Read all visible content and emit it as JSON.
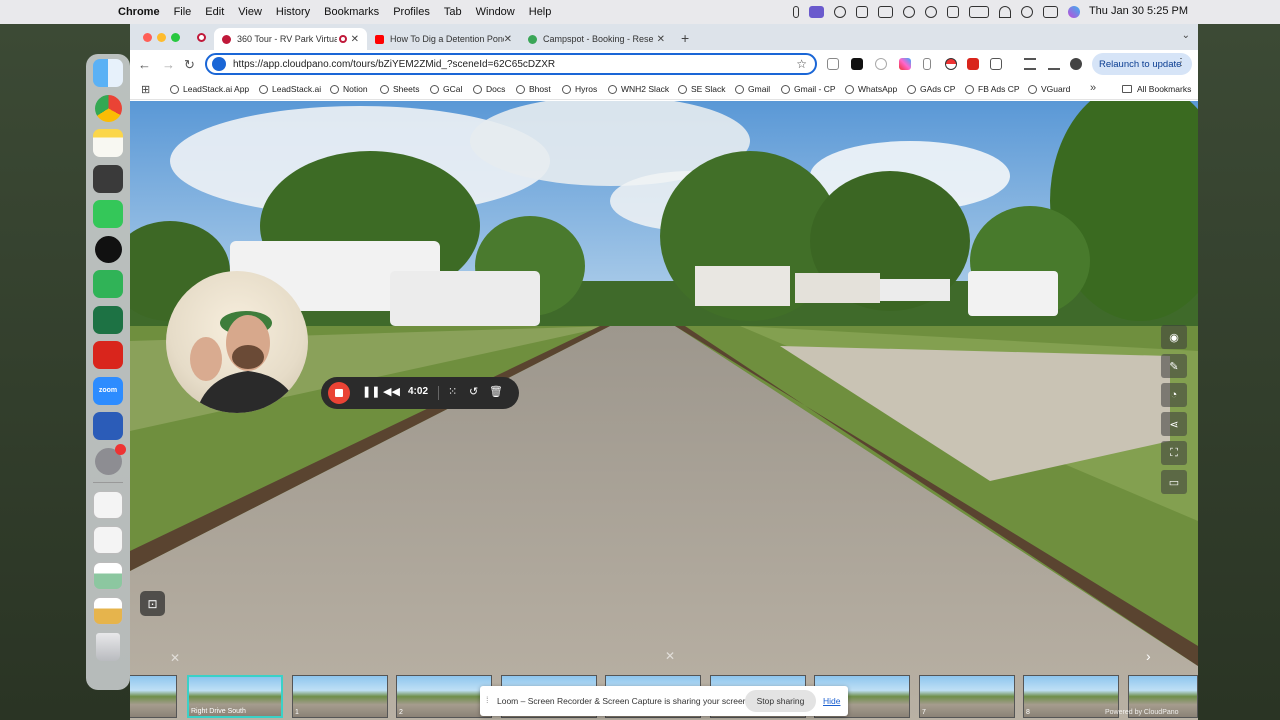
{
  "menubar": {
    "app_name": "Chrome",
    "items": [
      "File",
      "Edit",
      "View",
      "History",
      "Bookmarks",
      "Profiles",
      "Tab",
      "Window",
      "Help"
    ],
    "clock": "Thu Jan 30  5:25 PM"
  },
  "browser": {
    "tabs": [
      {
        "title": "360 Tour - RV Park Virtua",
        "active": true
      },
      {
        "title": "How To Dig a Detention Pond",
        "active": false
      },
      {
        "title": "Campspot - Booking - Reser",
        "active": false
      }
    ],
    "new_tab_label": "+",
    "tab_menu_label": "⌄",
    "url": "https://app.cloudpano.com/tours/bZiYEM2ZMid_?sceneId=62C65cDZXR",
    "relaunch_label": "Relaunch to update",
    "bookmarks": [
      "LeadStack.ai App",
      "LeadStack.ai",
      "Notion",
      "Sheets",
      "GCal",
      "Docs",
      "Bhost",
      "Hyros",
      "WNH2 Slack",
      "SE Slack",
      "Gmail",
      "Gmail - CP",
      "WhatsApp",
      "GAds CP",
      "FB Ads CP",
      "VGuard"
    ],
    "more_bookmarks_label": "»",
    "all_bookmarks_label": "All Bookmarks"
  },
  "loom": {
    "timer": "4:02",
    "share_message": "Loom – Screen Recorder & Screen Capture is sharing your screen.",
    "stop_sharing_label": "Stop sharing",
    "hide_label": "Hide"
  },
  "tour": {
    "selected_scene": "Right Drive South",
    "thumbnails": [
      {
        "caption": ""
      },
      {
        "caption": "Right Drive South"
      },
      {
        "caption": "1"
      },
      {
        "caption": "2"
      },
      {
        "caption": ""
      },
      {
        "caption": ""
      },
      {
        "caption": ""
      },
      {
        "caption": ""
      },
      {
        "caption": "7"
      },
      {
        "caption": "8"
      },
      {
        "caption": ""
      }
    ],
    "powered_by": "Powered by CloudPano"
  },
  "colors": {
    "accent_blue": "#1a66d6",
    "loom_red": "#ea4335",
    "selected_thumb": "#3ad1c7"
  }
}
